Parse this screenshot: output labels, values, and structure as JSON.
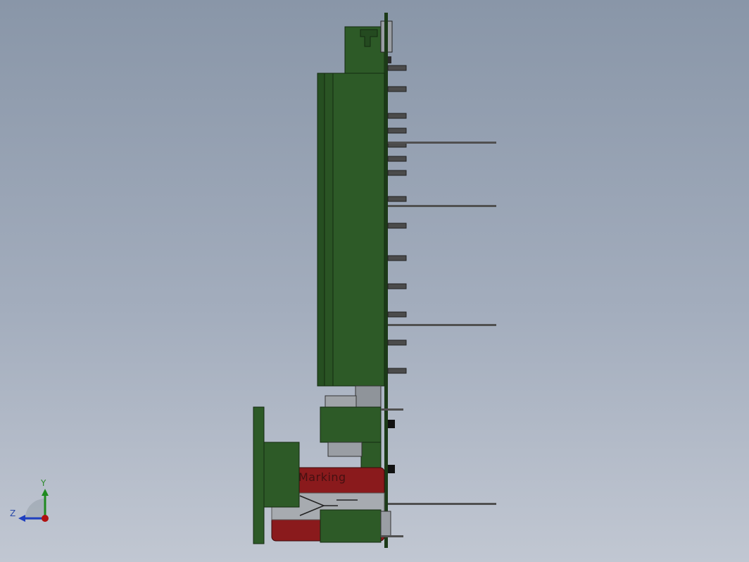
{
  "model_label": "Marking",
  "triad": {
    "y_label": "Y",
    "z_label": "Z",
    "y_color": "#1f8a1f",
    "z_color": "#1f3fbf",
    "x_color": "#b01010"
  },
  "colors": {
    "pcb_green": "#2d5a27",
    "pcb_edge": "#1c3a18",
    "pin_gray": "#4b4b4b",
    "cap_red": "#8a1a1c",
    "cap_silver": "#9a9ea4"
  }
}
